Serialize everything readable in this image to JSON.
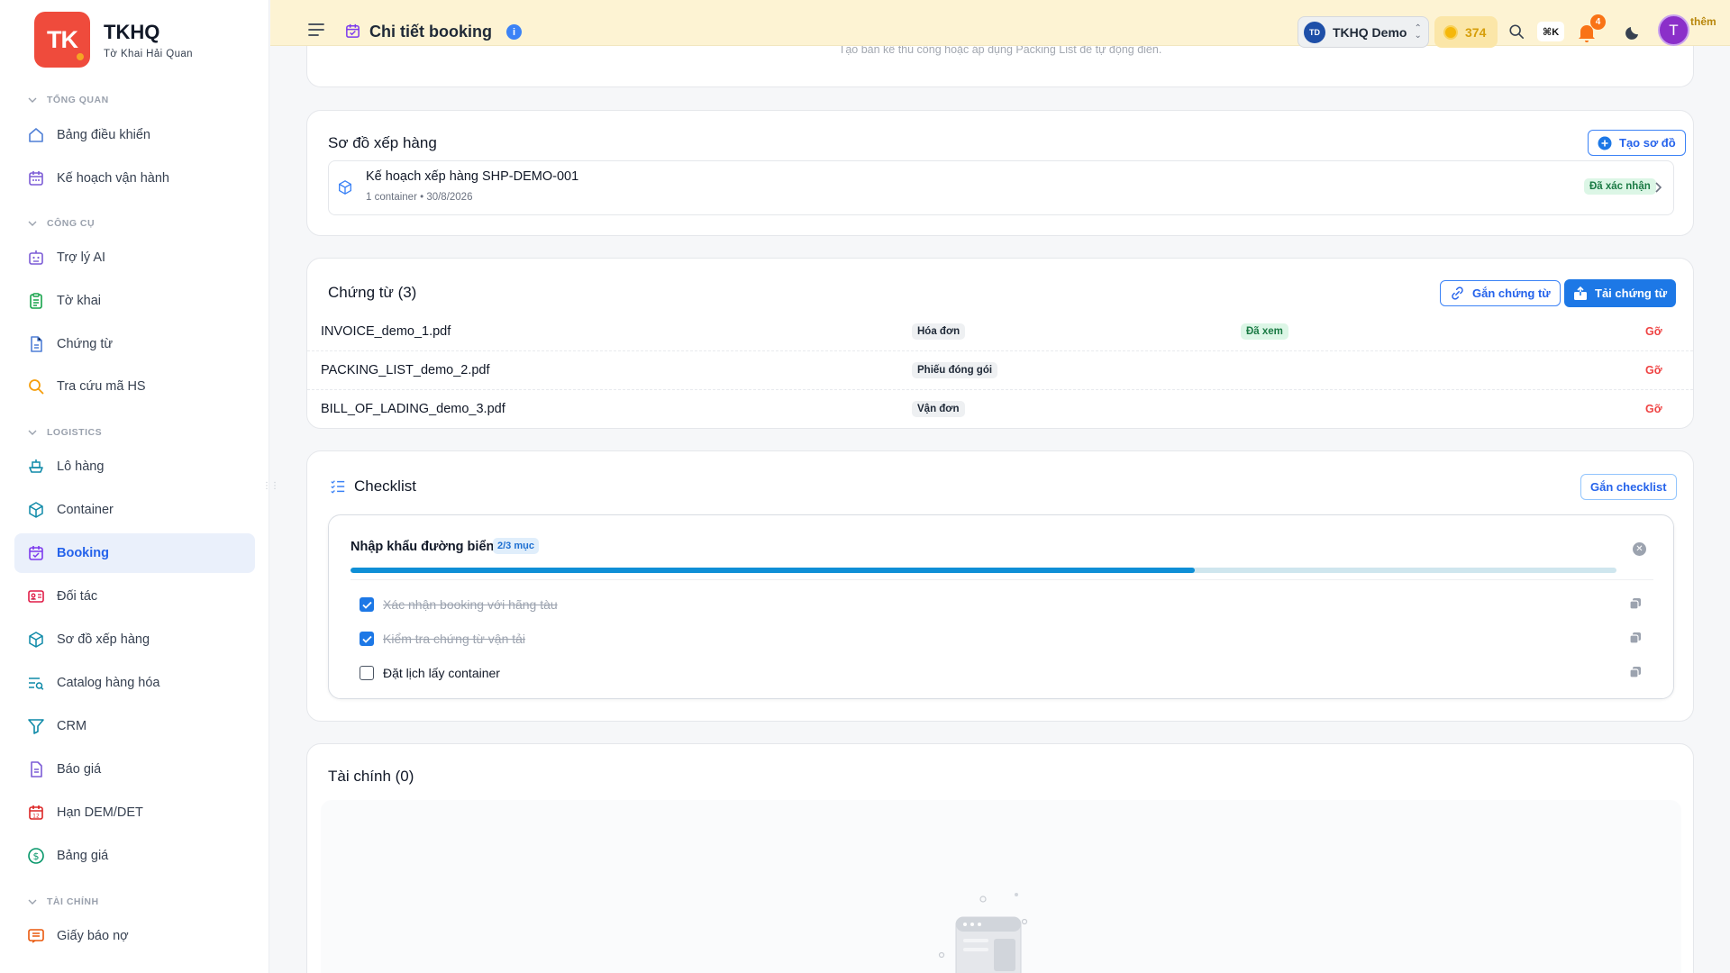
{
  "brand": {
    "logo_text": "TK",
    "name": "TKHQ",
    "subtitle": "Tờ Khai Hải Quan"
  },
  "sidebar": {
    "sections": [
      {
        "title": "TỔNG QUAN",
        "items": [
          {
            "label": "Bảng điều khiển",
            "icon": "home-icon"
          },
          {
            "label": "Kế hoạch vận hành",
            "icon": "calendar-grid-icon"
          }
        ]
      },
      {
        "title": "CÔNG CỤ",
        "items": [
          {
            "label": "Trợ lý AI",
            "icon": "bot-icon"
          },
          {
            "label": "Tờ khai",
            "icon": "clipboard-icon"
          },
          {
            "label": "Chứng từ",
            "icon": "document-icon"
          },
          {
            "label": "Tra cứu mã HS",
            "icon": "search-icon"
          }
        ]
      },
      {
        "title": "LOGISTICS",
        "items": [
          {
            "label": "Lô hàng",
            "icon": "ship-icon"
          },
          {
            "label": "Container",
            "icon": "box-icon"
          },
          {
            "label": "Booking",
            "icon": "calendar-check-icon",
            "active": true
          },
          {
            "label": "Đối tác",
            "icon": "contact-card-icon"
          },
          {
            "label": "Sơ đồ xếp hàng",
            "icon": "package-icon"
          },
          {
            "label": "Catalog hàng hóa",
            "icon": "list-search-icon"
          },
          {
            "label": "CRM",
            "icon": "funnel-icon"
          },
          {
            "label": "Báo giá",
            "icon": "file-text-icon"
          },
          {
            "label": "Hạn DEM/DET",
            "icon": "calendar-12-icon"
          },
          {
            "label": "Bảng giá",
            "icon": "dollar-circle-icon"
          }
        ]
      },
      {
        "title": "TÀI CHÍNH",
        "items": [
          {
            "label": "Giấy báo nợ",
            "icon": "message-lines-icon"
          }
        ]
      }
    ]
  },
  "header": {
    "title": "Chi tiết booking",
    "info_glyph": "i",
    "org_badge": "TD",
    "org_name": "TKHQ Demo",
    "credits": "374",
    "shortcut": "⌘K",
    "notification_count": "4",
    "avatar_letter": "T",
    "extra_label": "thêm"
  },
  "top_card": {
    "hint": "Tạo bản kê thủ công hoặc áp dụng Packing List để tự động điền."
  },
  "stowage": {
    "title": "Sơ đồ xếp hàng",
    "create_button": "Tạo sơ đồ",
    "plan": {
      "title": "Kế hoạch xếp hàng SHP-DEMO-001",
      "subtitle": "1 container • 30/8/2026",
      "status": "Đã xác nhận"
    }
  },
  "documents": {
    "title": "Chứng từ (3)",
    "attach_button": "Gắn chứng từ",
    "upload_button": "Tải chứng từ",
    "rows": [
      {
        "name": "INVOICE_demo_1.pdf",
        "type": "Hóa đơn",
        "status": "Đã xem",
        "action": "Gỡ"
      },
      {
        "name": "PACKING_LIST_demo_2.pdf",
        "type": "Phiếu đóng gói",
        "status": "",
        "action": "Gỡ"
      },
      {
        "name": "BILL_OF_LADING_demo_3.pdf",
        "type": "Vận đơn",
        "status": "",
        "action": "Gỡ"
      }
    ]
  },
  "checklist": {
    "title": "Checklist",
    "attach_button": "Gắn checklist",
    "group": {
      "name": "Nhập khẩu đường biển",
      "count": "2/3 mục",
      "progress": 0.6667,
      "items": [
        {
          "label": "Xác nhận booking với hãng tàu",
          "done": true
        },
        {
          "label": "Kiểm tra chứng từ vận tải",
          "done": true
        },
        {
          "label": "Đặt lịch lấy container",
          "done": false
        }
      ]
    }
  },
  "finance": {
    "title": "Tài chính (0)"
  },
  "colors": {
    "brand": "#ef4b3c",
    "accent": "#1d78e6",
    "header_bg": "#fdf3d3",
    "danger": "#ef4444",
    "success_bg": "#dcf6e6"
  }
}
